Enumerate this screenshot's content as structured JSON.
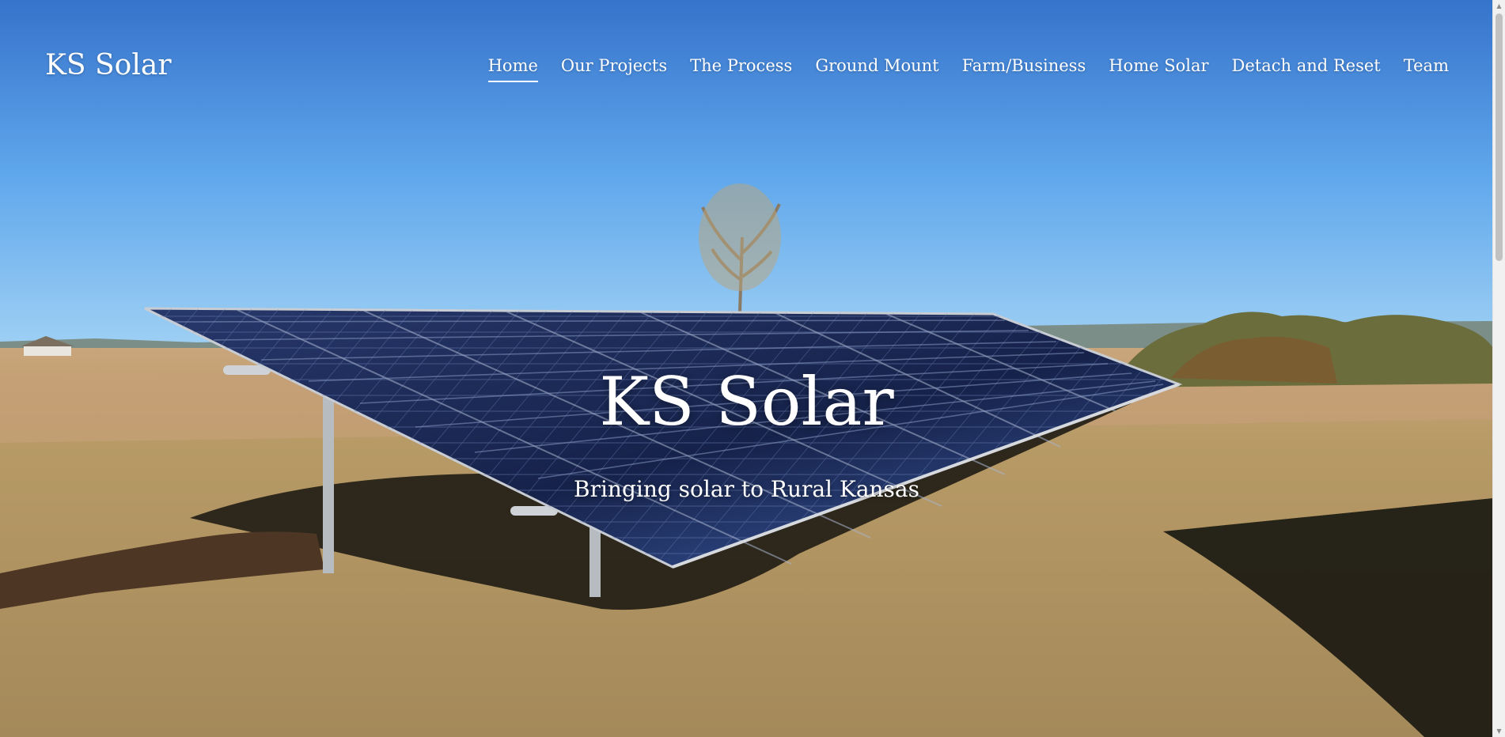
{
  "site": {
    "logo": "KS Solar"
  },
  "nav": {
    "items": [
      {
        "label": "Home",
        "active": true
      },
      {
        "label": "Our Projects",
        "active": false
      },
      {
        "label": "The Process",
        "active": false
      },
      {
        "label": "Ground Mount",
        "active": false
      },
      {
        "label": "Farm/Business",
        "active": false
      },
      {
        "label": "Home Solar",
        "active": false
      },
      {
        "label": "Detach and Reset",
        "active": false
      },
      {
        "label": "Team",
        "active": false
      }
    ]
  },
  "hero": {
    "title": "KS Solar",
    "subtitle": "Bringing solar to Rural Kansas"
  },
  "colors": {
    "sky_top": "#3a79cf",
    "sky_bottom": "#8cc4f2",
    "grass": "#b49a63",
    "panel": "#1b2a52",
    "text": "#ffffff"
  }
}
